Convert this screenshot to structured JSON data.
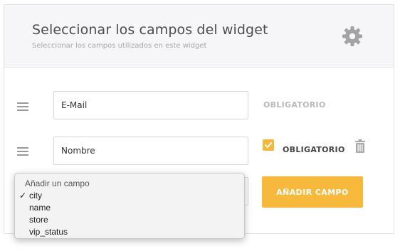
{
  "header": {
    "title": "Seleccionar los campos del widget",
    "subtitle": "Seleccionar los campos utilizados en este widget",
    "settings_icon": "gear-icon"
  },
  "rows": [
    {
      "value": "E-Mail",
      "required_label": "OBLIGATORIO",
      "required_checked": false
    },
    {
      "value": "Nombre",
      "required_label": "OBLIGATORIO",
      "required_checked": true
    }
  ],
  "add_field": {
    "dropdown_placeholder": "Añadir un campo",
    "options": [
      "city",
      "name",
      "store",
      "vip_status"
    ],
    "selected": "city",
    "button_label": "AÑADIR CAMPO"
  },
  "colors": {
    "accent": "#f6b93b",
    "header_bg": "#f6f6f8"
  }
}
